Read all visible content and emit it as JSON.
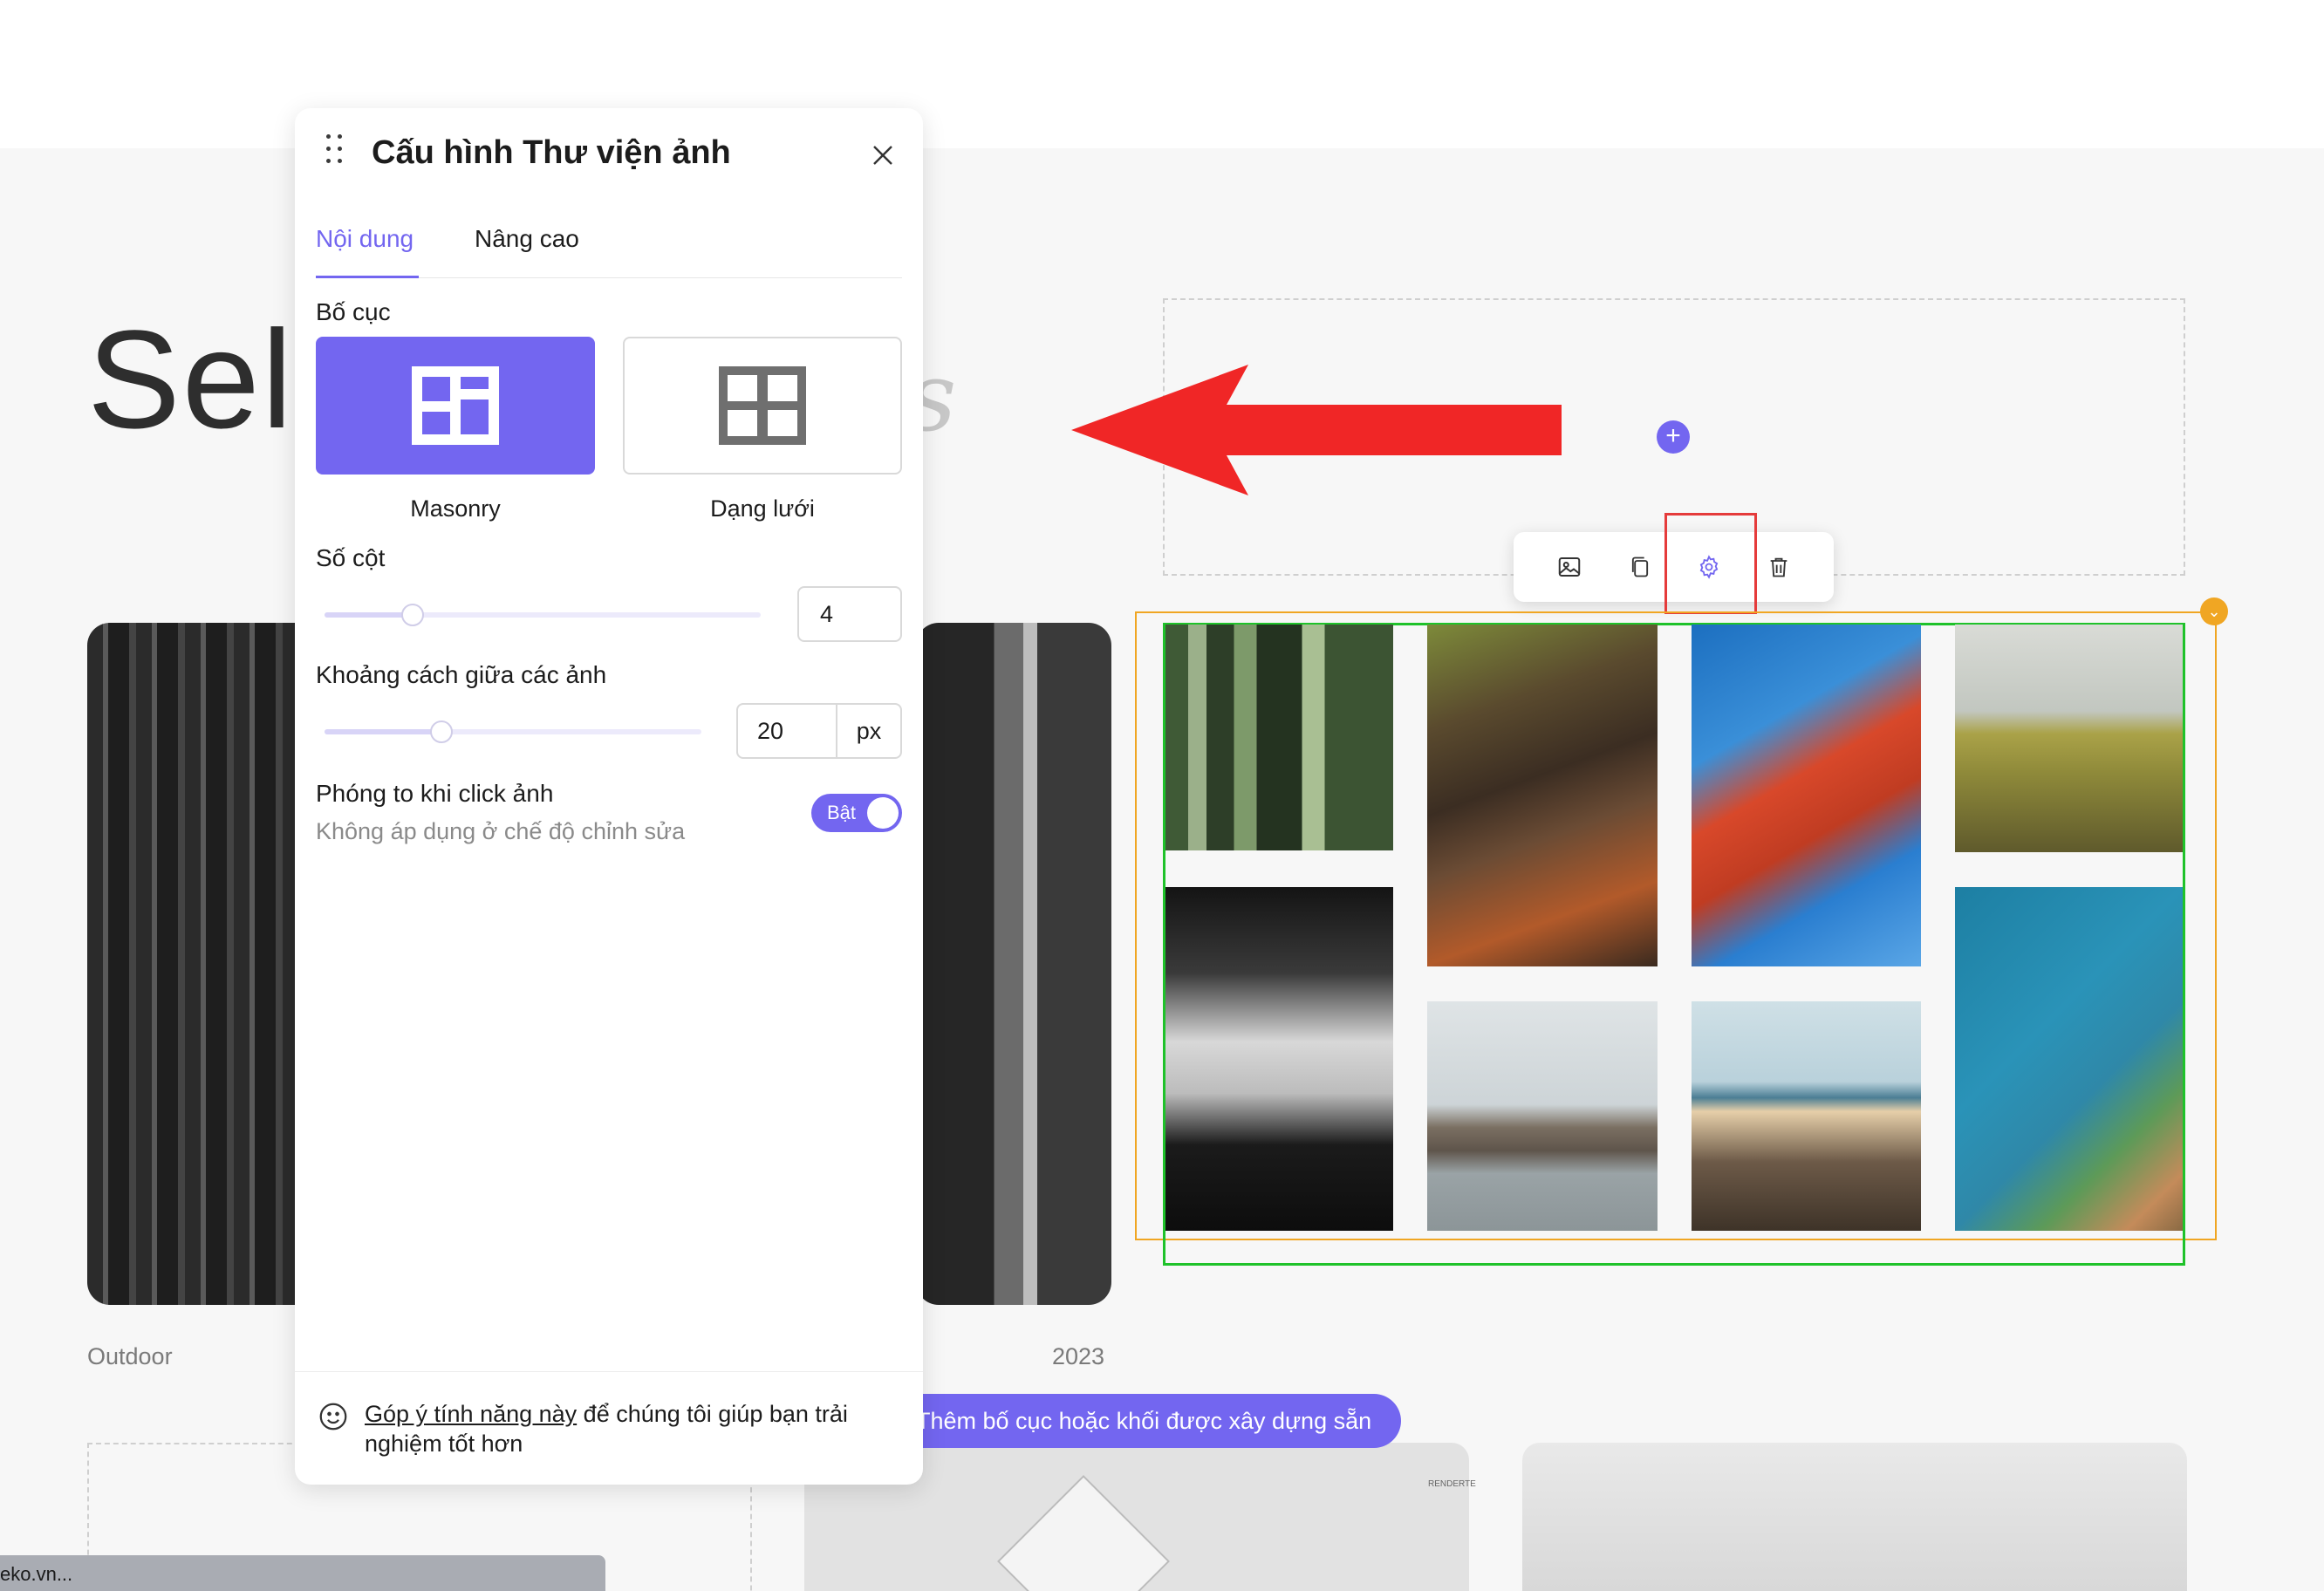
{
  "page": {
    "hero_title": "Sele",
    "hero_italic_fragment": "s",
    "caption_left": "Outdoor",
    "caption_right": "2023",
    "add_layout_button": "Thêm bố cục hoặc khối được xây dựng sẵn",
    "status_url": "eko.vn...",
    "card_watermark": "RENDERTE"
  },
  "toolbar": {
    "items": [
      {
        "name": "replace-image",
        "icon": "image-swap-icon"
      },
      {
        "name": "duplicate",
        "icon": "copy-icon"
      },
      {
        "name": "settings",
        "icon": "gear-icon"
      },
      {
        "name": "delete",
        "icon": "trash-icon"
      }
    ],
    "highlighted": "settings"
  },
  "gallery": {
    "images": [
      "bamboo",
      "tree-log",
      "red-bridge",
      "wheat-field",
      "man-silhouette",
      "rocks-water",
      "pier",
      "coastline"
    ]
  },
  "panel": {
    "title": "Cấu hình Thư viện ảnh",
    "tabs": [
      {
        "label": "Nội dung",
        "active": true
      },
      {
        "label": "Nâng cao",
        "active": false
      }
    ],
    "layout": {
      "label": "Bố cục",
      "options": [
        {
          "label": "Masonry",
          "selected": true
        },
        {
          "label": "Dạng lưới",
          "selected": false
        }
      ]
    },
    "columns": {
      "label": "Số cột",
      "value": "4"
    },
    "gap": {
      "label": "Khoảng cách giữa các ảnh",
      "value": "20",
      "unit": "px"
    },
    "zoom": {
      "label": "Phóng to khi click ảnh",
      "hint": "Không áp dụng ở chế độ chỉnh sửa",
      "toggle_label": "Bật",
      "enabled": true
    },
    "feedback": {
      "link": "Góp ý tính năng này",
      "text": " để chúng tôi giúp bạn trải nghiệm tốt hơn"
    }
  },
  "colors": {
    "accent": "#7366f0",
    "arrow": "#f02626",
    "gallery_selected": "#1fc22a",
    "gallery_hover": "#f0a623",
    "highlight": "#e53b3b"
  }
}
